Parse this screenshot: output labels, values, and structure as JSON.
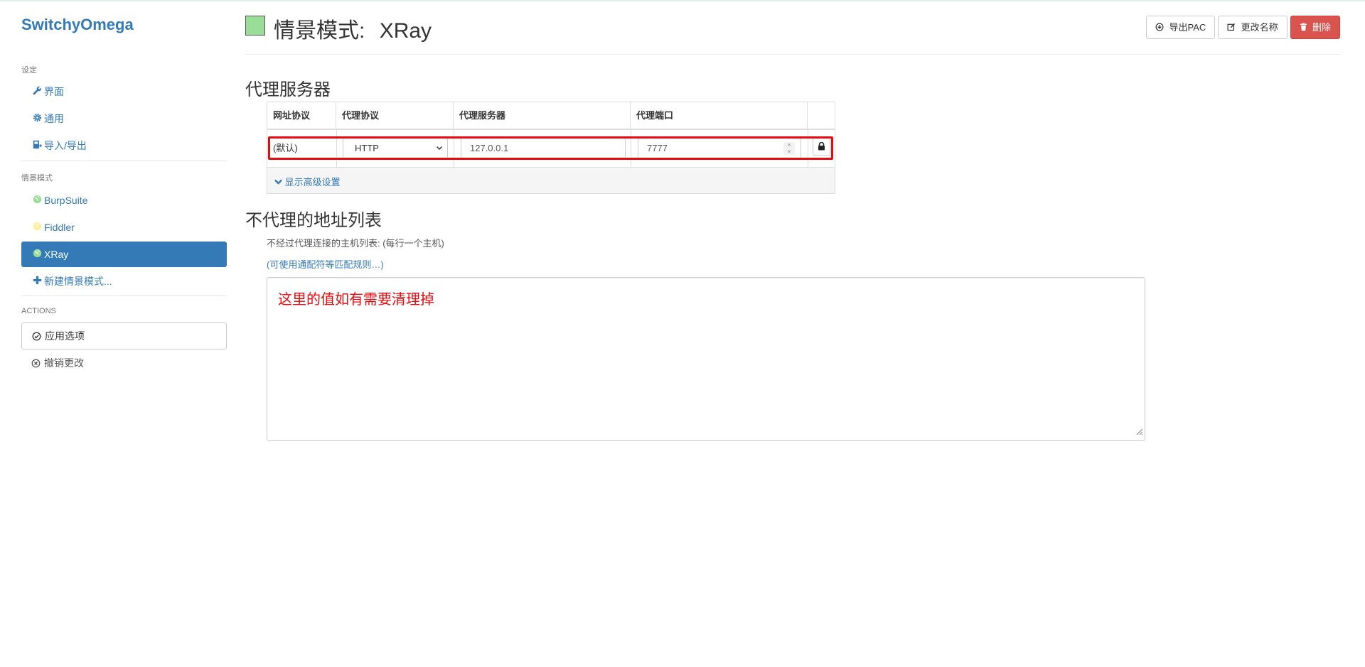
{
  "app": {
    "brand": "SwitchyOmega"
  },
  "sidebar": {
    "settings_header": "设定",
    "settings_items": [
      {
        "label": "界面",
        "icon": "wrench-icon"
      },
      {
        "label": "通用",
        "icon": "gear-icon"
      },
      {
        "label": "导入/导出",
        "icon": "import-export-icon"
      }
    ],
    "profiles_header": "情景模式",
    "profiles": [
      {
        "label": "BurpSuite",
        "icon": "globe-icon",
        "color": "#99dd99"
      },
      {
        "label": "Fiddler",
        "icon": "globe-icon",
        "color": "#ffee99"
      },
      {
        "label": "XRay",
        "icon": "globe-icon",
        "color": "#99dd99",
        "active": true
      }
    ],
    "new_profile": "新建情景模式...",
    "actions_header": "ACTIONS",
    "apply_label": "应用选项",
    "discard_label": "撤销更改"
  },
  "header": {
    "title_prefix": "情景模式:",
    "profile_name": "XRay",
    "profile_color": "#99dd99",
    "export_pac": "导出PAC",
    "rename": "更改名称",
    "delete": "删除"
  },
  "proxy_section": {
    "title": "代理服务器",
    "columns": [
      "网址协议",
      "代理协议",
      "代理服务器",
      "代理端口"
    ],
    "row": {
      "scheme": "(默认)",
      "protocol": "HTTP",
      "server": "127.0.0.1",
      "port": "7777"
    },
    "show_advanced": "显示高级设置"
  },
  "bypass_section": {
    "title": "不代理的地址列表",
    "help": "不经过代理连接的主机列表: (每行一个主机)",
    "wildcard_link": "(可使用通配符等匹配规则…)",
    "note": "这里的值如有需要清理掉"
  },
  "colors": {
    "accent": "#337ab7",
    "danger": "#d9534f",
    "highlight": "#e8080d"
  }
}
